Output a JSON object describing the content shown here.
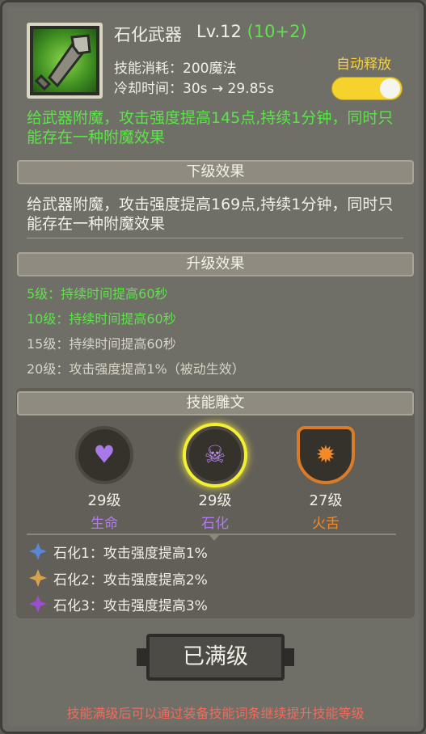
{
  "skill": {
    "name": "石化武器",
    "level_text": "Lv.12",
    "level_bonus": "(10+2)",
    "cost": "技能消耗：200魔法",
    "cooldown": "冷却时间：30s → 29.85s",
    "icon": "stone-weapon-icon"
  },
  "auto_cast": {
    "label": "自动释放",
    "enabled": true
  },
  "current_effect": "给武器附魔，攻击强度提高145点,持续1分钟，同时只能存在一种附魔效果",
  "next_section": {
    "title": "下级效果",
    "text": "给武器附魔，攻击强度提高169点,持续1分钟，同时只能存在一种附魔效果"
  },
  "upgrade_section": {
    "title": "升级效果",
    "items": [
      {
        "text": "5级：持续时间提高60秒",
        "achieved": true
      },
      {
        "text": "10级：持续时间提高60秒",
        "achieved": true
      },
      {
        "text": "15级：持续时间提高60秒",
        "achieved": false
      },
      {
        "text": "20级：攻击强度提高1%（被动生效）",
        "achieved": false
      }
    ]
  },
  "carving_section": {
    "title": "技能雕文",
    "glyphs": [
      {
        "level": "29级",
        "name": "生命",
        "icon": "heart-icon",
        "color": "#b07af0"
      },
      {
        "level": "29级",
        "name": "石化",
        "icon": "skull-icon",
        "color": "#b07af0",
        "selected": true
      },
      {
        "level": "27级",
        "name": "火舌",
        "icon": "flame-icon",
        "color": "#f28a2a"
      }
    ],
    "bonuses": [
      {
        "text": "石化1：攻击强度提高1%",
        "star_color": "#5a86d6"
      },
      {
        "text": "石化2：攻击强度提高2%",
        "star_color": "#d6a24a"
      },
      {
        "text": "石化3：攻击强度提高3%",
        "star_color": "#9a4ed0"
      }
    ]
  },
  "max_button": {
    "label": "已满级"
  },
  "footer_note": "技能满级后可以通过装备技能词条继续提升技能等级"
}
